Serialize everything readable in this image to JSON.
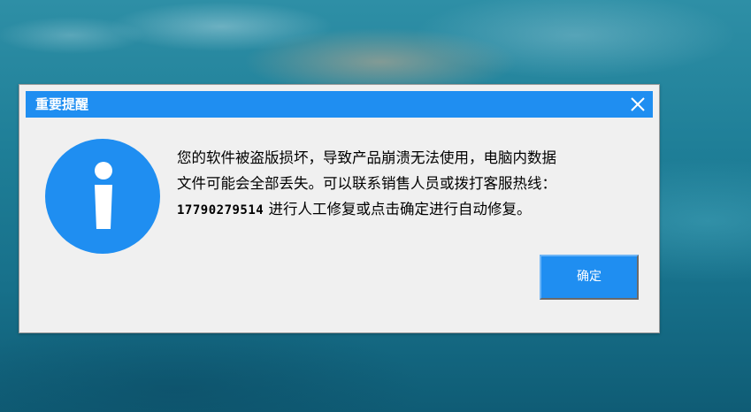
{
  "dialog": {
    "title": "重要提醒",
    "message": {
      "line1": "您的软件被盗版损坏，导致产品崩溃无法使用，电脑内数据",
      "line2": "文件可能会全部丢失。可以联系销售人员或拨打客服热线：",
      "phone": "17790279514",
      "line3_suffix": " 进行人工修复或点击确定进行自动修复。"
    },
    "ok_label": "确定"
  },
  "icons": {
    "dialog_icon": "info-icon",
    "close": "close-icon"
  },
  "colors": {
    "accent": "#1f8ef1",
    "dialog_background": "#f0f0f0",
    "title_text": "#ffffff",
    "icon_glyph": "#ffffff"
  }
}
